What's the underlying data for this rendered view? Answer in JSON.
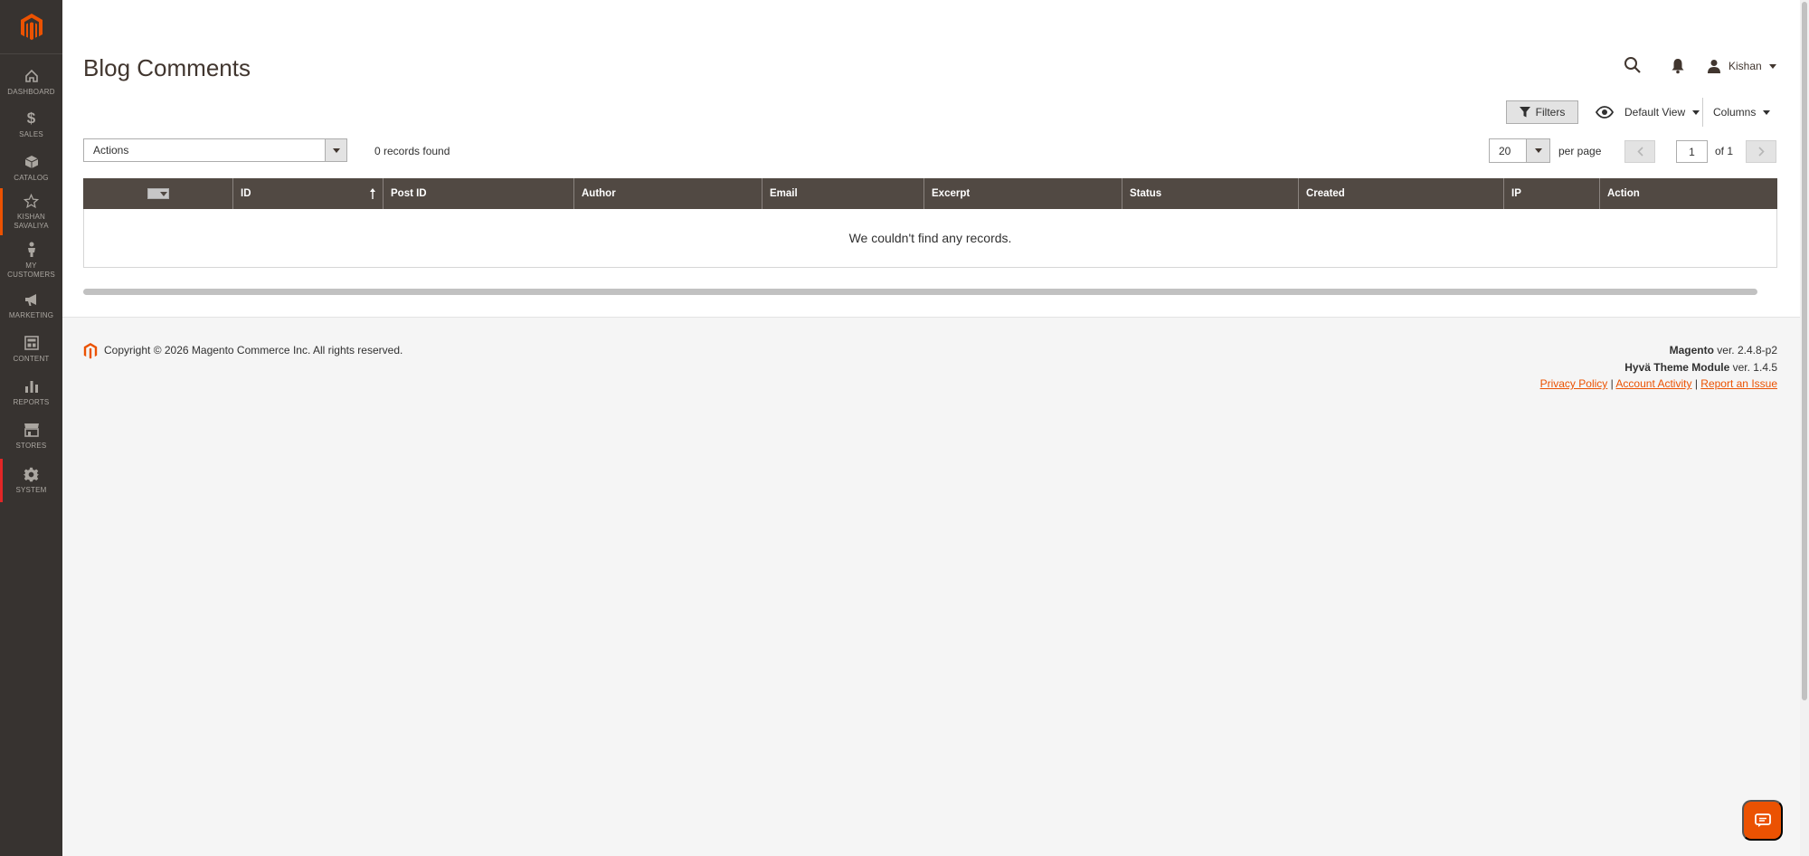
{
  "sidebar": {
    "items": [
      {
        "label": "Dashboard",
        "icon": "home-icon"
      },
      {
        "label": "Sales",
        "icon": "dollar-icon"
      },
      {
        "label": "Catalog",
        "icon": "cube-icon"
      },
      {
        "label": "Kishan Savaliya",
        "icon": "star-icon"
      },
      {
        "label": "My Customers",
        "icon": "person-icon"
      },
      {
        "label": "Marketing",
        "icon": "megaphone-icon"
      },
      {
        "label": "Content",
        "icon": "layout-icon"
      },
      {
        "label": "Reports",
        "icon": "bar-chart-icon"
      },
      {
        "label": "Stores",
        "icon": "store-icon"
      },
      {
        "label": "System",
        "icon": "gear-icon"
      }
    ]
  },
  "header": {
    "title": "Blog Comments",
    "user_name": "Kishan"
  },
  "toolbar": {
    "filters_label": "Filters",
    "view_label": "Default View",
    "columns_label": "Columns",
    "actions_label": "Actions",
    "records_found": "0 records found",
    "per_page_value": "20",
    "per_page_label": "per page",
    "page_value": "1",
    "page_of": "of 1"
  },
  "grid": {
    "columns": [
      "ID",
      "Post ID",
      "Author",
      "Email",
      "Excerpt",
      "Status",
      "Created",
      "IP",
      "Action"
    ],
    "empty_message": "We couldn't find any records."
  },
  "footer": {
    "copyright": "Copyright © 2026 Magento Commerce Inc. All rights reserved.",
    "magento_name": "Magento",
    "magento_version": " ver. 2.4.8-p2",
    "hyva_name": "Hyvä Theme Module",
    "hyva_version": " ver. 1.4.5",
    "links": [
      "Privacy Policy",
      "Account Activity",
      "Report an Issue"
    ],
    "link_separator": "|"
  },
  "colors": {
    "accent": "#eb5202",
    "sidebar_bg": "#373330",
    "grid_header_bg": "#514943"
  }
}
